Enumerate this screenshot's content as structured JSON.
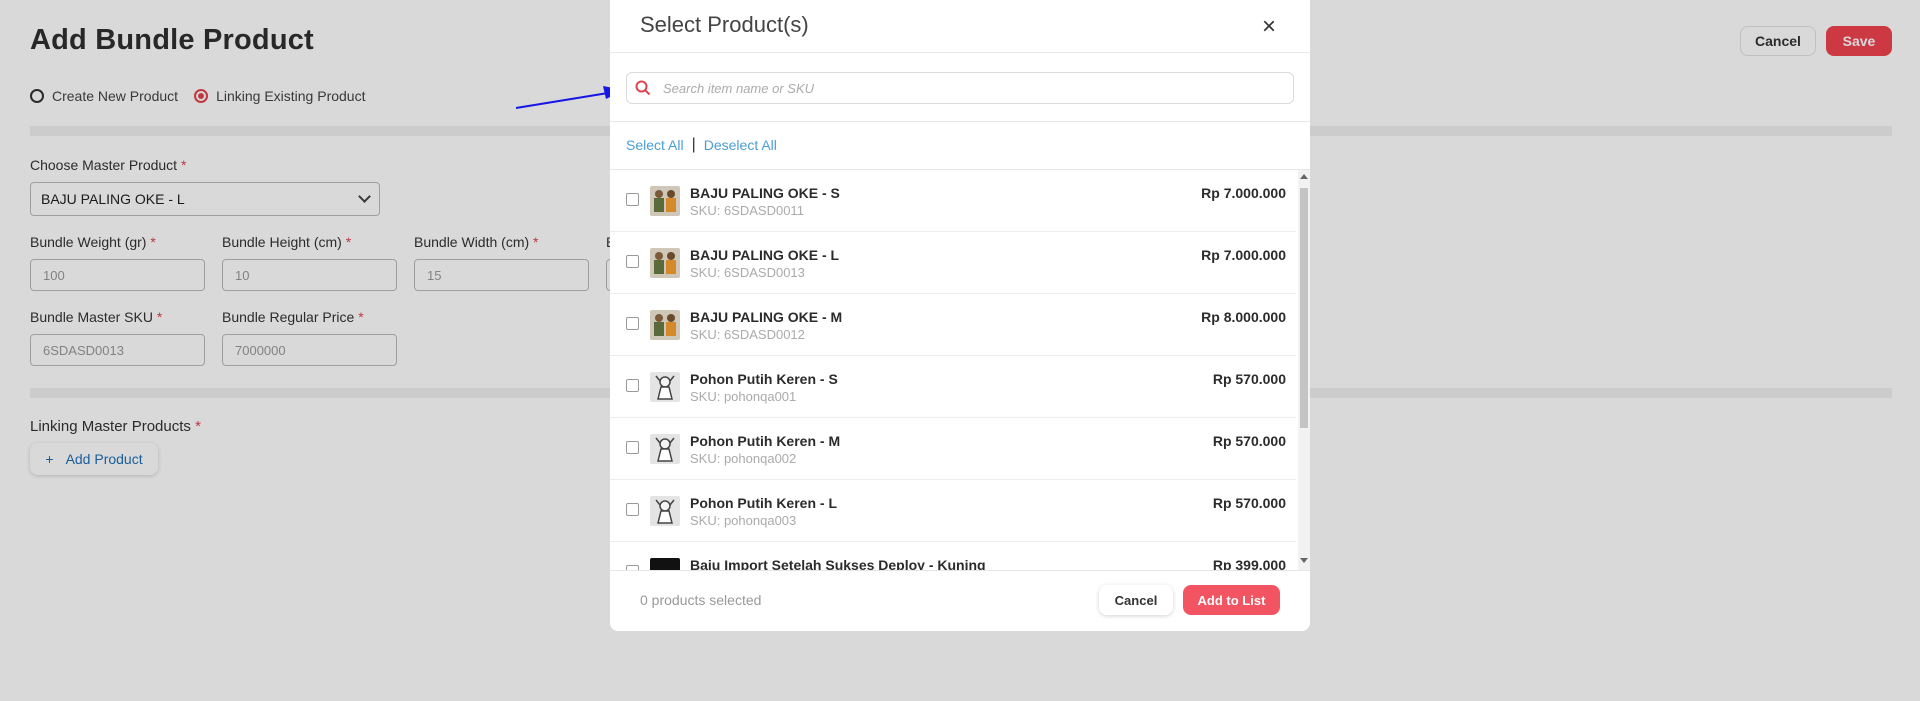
{
  "page": {
    "title": "Add Bundle Product",
    "header_cancel": "Cancel",
    "header_save": "Save",
    "radio_options": [
      "Create New Product",
      "Linking Existing Product"
    ],
    "selected_radio": "Linking Existing Product",
    "choose_master_label": "Choose Master Product",
    "choose_master_value": "BAJU PALING OKE - L",
    "fields": [
      {
        "label": "Bundle Weight (gr)",
        "value": "100"
      },
      {
        "label": "Bundle Height (cm)",
        "value": "10"
      },
      {
        "label": "Bundle Width (cm)",
        "value": "15"
      },
      {
        "label": "B",
        "value": ""
      },
      {
        "label": "Bundle Master SKU",
        "value": "6SDASD0013"
      },
      {
        "label": "Bundle Regular Price",
        "value": "7000000"
      }
    ],
    "required_mark": "*",
    "linking_label": "Linking Master Products",
    "add_product_label": "Add Product",
    "add_product_plus": "+"
  },
  "modal": {
    "title": "Select Product(s)",
    "close_glyph": "×",
    "search_placeholder": "Search item name or SKU",
    "select_all": "Select All",
    "separator": "|",
    "deselect_all": "Deselect All",
    "products": [
      {
        "name": "BAJU PALING OKE - S",
        "sku": "SKU: 6SDASD0011",
        "price": "Rp 7.000.000",
        "thumb": "people-thumb"
      },
      {
        "name": "BAJU PALING OKE - L",
        "sku": "SKU: 6SDASD0013",
        "price": "Rp 7.000.000",
        "thumb": "people-thumb"
      },
      {
        "name": "BAJU PALING OKE - M",
        "sku": "SKU: 6SDASD0012",
        "price": "Rp 8.000.000",
        "thumb": "people-thumb"
      },
      {
        "name": "Pohon Putih Keren - S",
        "sku": "SKU: pohonqa001",
        "price": "Rp 570.000",
        "thumb": "figure-thumb"
      },
      {
        "name": "Pohon Putih Keren - M",
        "sku": "SKU: pohonqa002",
        "price": "Rp 570.000",
        "thumb": "figure-thumb"
      },
      {
        "name": "Pohon Putih Keren - L",
        "sku": "SKU: pohonqa003",
        "price": "Rp 570.000",
        "thumb": "figure-thumb"
      },
      {
        "name": "Baju Import Setelah Sukses Deploy - Kuning",
        "sku": "",
        "price": "Rp 399.000",
        "thumb": "dark-thumb"
      }
    ],
    "selected_count": "0 products selected",
    "cancel_label": "Cancel",
    "add_to_list_label": "Add to List"
  },
  "colors": {
    "accent_red": "#f0444f",
    "link_blue": "#4a9fd4",
    "annotation_arrow": "#1616e6"
  }
}
